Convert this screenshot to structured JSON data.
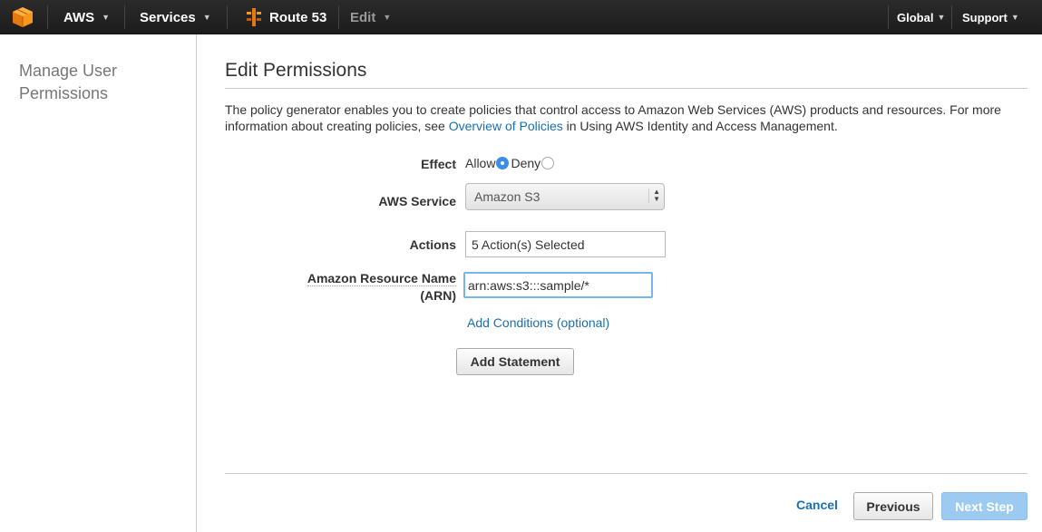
{
  "topbar": {
    "aws_label": "AWS",
    "services_label": "Services",
    "route53_label": "Route 53",
    "edit_label": "Edit",
    "global_label": "Global",
    "support_label": "Support",
    "caret": "▼"
  },
  "sidebar": {
    "title": "Manage User Permissions"
  },
  "main": {
    "title": "Edit Permissions",
    "intro_text_1": "The policy generator enables you to create policies that control access to Amazon Web Services (AWS) products and resources. For more information about creating policies, see",
    "intro_link": "Overview of Policies",
    "intro_text_2": "in Using AWS Identity and Access Management."
  },
  "form": {
    "effect_label": "Effect",
    "allow_label": "Allow",
    "deny_label": "Deny",
    "effect_selected": "Allow",
    "service_label": "AWS Service",
    "service_value": "Amazon S3",
    "actions_label": "Actions",
    "actions_value": "5 Action(s) Selected",
    "arn_label_1": "Amazon Resource Name",
    "arn_label_2": "(ARN)",
    "arn_value": "arn:aws:s3:::sample/*",
    "add_conditions": "Add Conditions (optional)",
    "add_statement": "Add Statement"
  },
  "footer": {
    "cancel": "Cancel",
    "previous": "Previous",
    "next": "Next Step"
  },
  "colors": {
    "topbar": "#1c1c1c",
    "link": "#1a6fb3",
    "next_button": "#9ccaf0",
    "aws_orange": "#f90"
  }
}
